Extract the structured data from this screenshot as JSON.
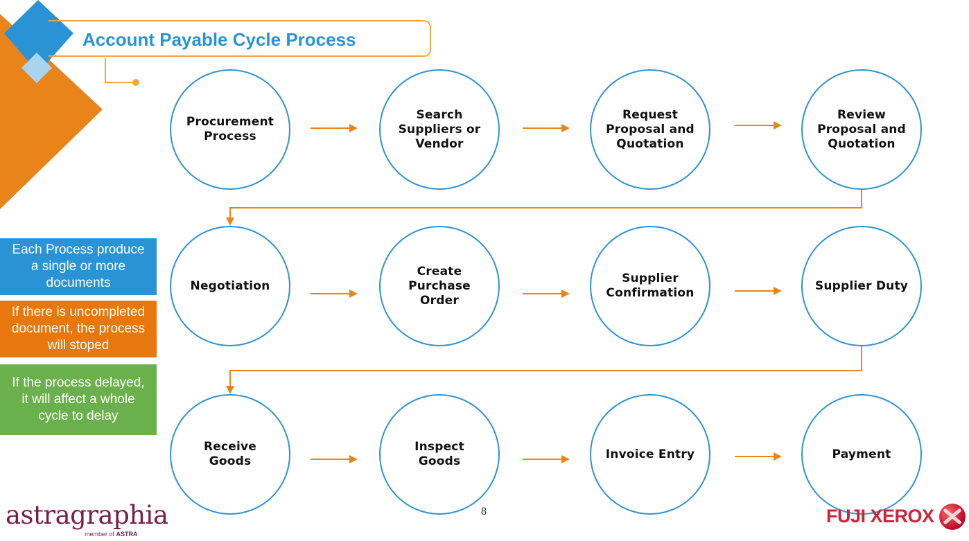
{
  "title": "Account Payable Cycle Process",
  "colors": {
    "accent_blue": "#2a93d5",
    "accent_orange": "#e8841a",
    "light_blue": "#a9d4f0",
    "note_green": "#6ab04c",
    "title_border": "#f4a63a"
  },
  "process_steps": [
    {
      "label": "Procurement\nProcess"
    },
    {
      "label": "Search\nSuppliers or\nVendor"
    },
    {
      "label": "Request\nProposal and\nQuotation"
    },
    {
      "label": "Review\nProposal and\nQuotation"
    },
    {
      "label": "Negotiation"
    },
    {
      "label": "Create\nPurchase\nOrder"
    },
    {
      "label": "Supplier\nConfirmation"
    },
    {
      "label": "Supplier Duty"
    },
    {
      "label": "Receive\nGoods"
    },
    {
      "label": "Inspect\nGoods"
    },
    {
      "label": "Invoice Entry"
    },
    {
      "label": "Payment"
    }
  ],
  "notes": [
    {
      "text": "Each Process produce\na single or more\ndocuments",
      "color": "#2a93d5"
    },
    {
      "text": "If there is uncompleted\ndocument, the process\nwill stoped",
      "color": "#e8770d"
    },
    {
      "text": "If the process delayed,\nit will affect a whole\ncycle to delay",
      "color": "#6ab04c"
    }
  ],
  "footer": {
    "page_number": "8",
    "left_logo": {
      "name": "astragraphia",
      "tagline_prefix": "member of ",
      "tagline_brand": "ASTRA"
    },
    "right_logo": {
      "name": "FUJI XEROX"
    }
  }
}
